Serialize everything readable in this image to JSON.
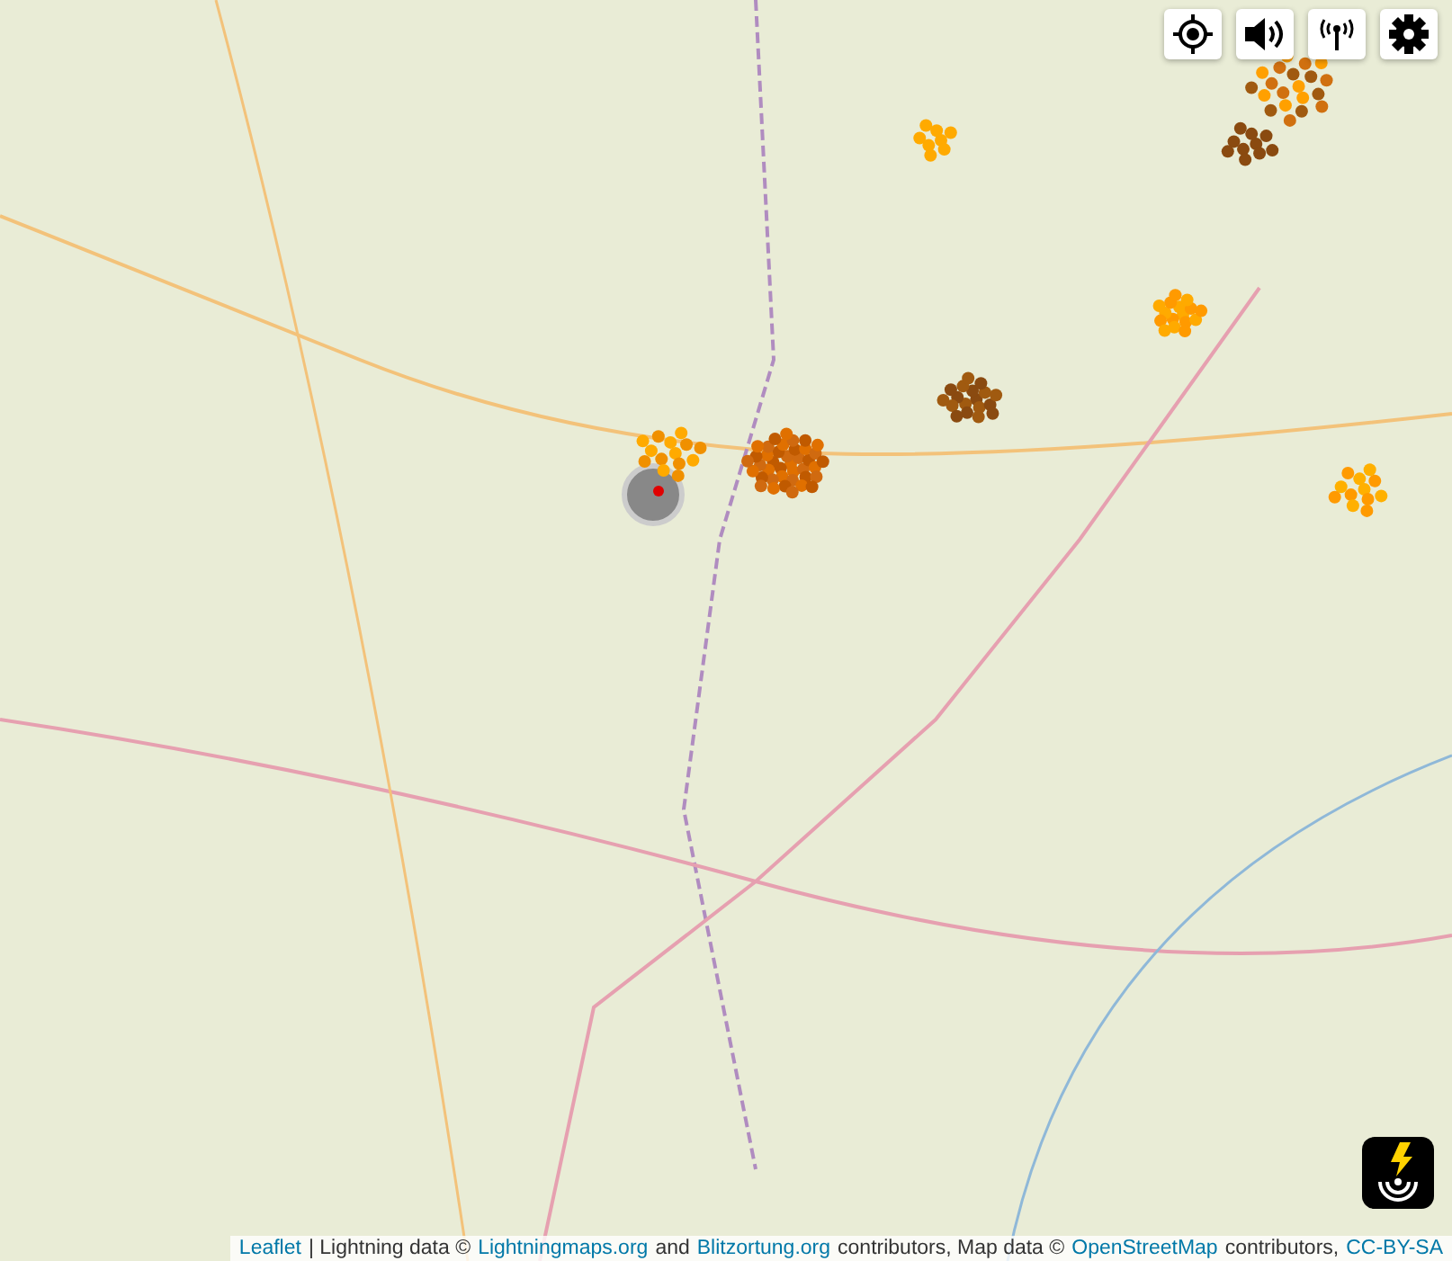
{
  "map_controls": [
    {
      "kind": "locate"
    },
    {
      "kind": "sound"
    },
    {
      "kind": "signal"
    },
    {
      "kind": "settings"
    }
  ],
  "attribution": [
    {
      "kind": "link",
      "text": "Leaflet"
    },
    {
      "kind": "plain",
      "text": "| Lightning data ©"
    },
    {
      "kind": "link",
      "text": "Lightningmaps.org"
    },
    {
      "kind": "plain",
      "text": "and"
    },
    {
      "kind": "link",
      "text": "Blitzortung.org"
    },
    {
      "kind": "plain",
      "text": "contributors, Map data ©"
    },
    {
      "kind": "link",
      "text": "OpenStreetMap"
    },
    {
      "kind": "plain",
      "text": "contributors,"
    },
    {
      "kind": "link",
      "text": "CC-BY-SA"
    }
  ]
}
